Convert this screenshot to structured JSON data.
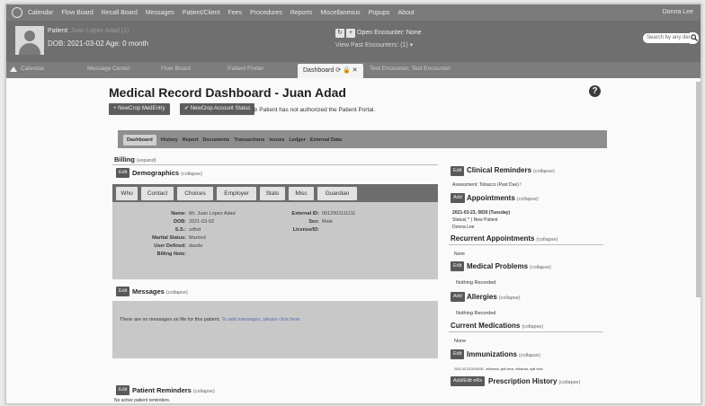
{
  "menu": {
    "items": [
      "Calendar",
      "Flow Board",
      "Recall Board",
      "Messages",
      "Patient/Client",
      "Fees",
      "Procedures",
      "Reports",
      "Miscellaneous",
      "Popups",
      "About"
    ],
    "user": "Donna Lee"
  },
  "patient_header": {
    "patient_label": "Patient:",
    "patient_name_obscured": "Juan Lopez Adad (1)",
    "dob_line": "DOB: 2021-03-02 Age: 0 month",
    "open_encounter": "Open Encounter: None",
    "past_encounters": "View Past Encounters: (1) ▾",
    "search_placeholder": "Search by any demographics"
  },
  "tabs": {
    "items": [
      "Calendar",
      "Message Center",
      "Flow Board",
      "Patient Finder"
    ],
    "active": "Dashboard",
    "right_tab": "Test Encounter, Test Encounter",
    "tab_icons": "⟳ 🔒 ✕"
  },
  "page": {
    "title": "Medical Record Dashboard - Juan Adad",
    "btn_newcrop_med": "NewCrop MedEntry",
    "btn_newcrop_acct": "NewCrop Account Status",
    "portal_note": "Patient has not authorized the Patient Portal.",
    "nav": [
      "Dashboard",
      "History",
      "Report",
      "Documents",
      "Transactions",
      "Issues",
      "Ledger",
      "External Data"
    ]
  },
  "left": {
    "billing": {
      "title": "Billing",
      "sub": "(expand)"
    },
    "demographics": {
      "edit": "Edit",
      "title": "Demographics",
      "sub": "(collapse)"
    },
    "demo_tabs": [
      "Who",
      "Contact",
      "Choices",
      "Employer",
      "Stats",
      "Misc",
      "Guardian"
    ],
    "fields": {
      "name_l": "Name:",
      "name_v": "Mr. Juan Lopez Adad",
      "dob_l": "DOB:",
      "dob_v": "2021-03-02",
      "ss_l": "S.S.:",
      "ss_v": "sdfsd",
      "marital_l": "Marital Status:",
      "marital_v": "Married",
      "userdef_l": "User Defined:",
      "userdef_v": "dasda",
      "billnote_l": "Billing Note:",
      "extid_l": "External ID:",
      "extid_v": "0012001111111",
      "sex_l": "Sex:",
      "sex_v": "Male",
      "license_l": "License/ID:"
    },
    "messages": {
      "edit": "Edit",
      "title": "Messages",
      "sub": "(collapse)",
      "text": "There are no messages on file for this patient.",
      "link": "To add messages, please click here."
    },
    "reminders": {
      "edit": "Edit",
      "title": "Patient Reminders",
      "sub": "(collapse)",
      "text": "No active patient reminders."
    }
  },
  "right": {
    "clinical": {
      "edit": "Edit",
      "title": "Clinical Reminders",
      "sub": "(collapse)",
      "text": "Assessment: Tobacco (Past Due) !"
    },
    "appointments": {
      "edit": "Add",
      "title": "Appointments",
      "sub": "(collapse)",
      "l1": "2021-03-23, 0830 (Tuesday)",
      "l2": "Status( * ) New Patient",
      "l3": "Donna Lee"
    },
    "recurrent": {
      "title": "Recurrent Appointments",
      "sub": "(collapse)",
      "text": "None"
    },
    "problems": {
      "edit": "Edit",
      "title": "Medical Problems",
      "sub": "(collapse)",
      "text": "Nothing Recorded"
    },
    "allergies": {
      "edit": "Add",
      "title": "Allergies",
      "sub": "(collapse)",
      "text": "Nothing Recorded"
    },
    "medications": {
      "title": "Current Medications",
      "sub": "(collapse)",
      "text": "None"
    },
    "immunizations": {
      "edit": "Edit",
      "title": "Immunizations",
      "sub": "(collapse)",
      "text": "2021-03-23 00:00:00 - influenza, split virus, influenza, split virus"
    },
    "prescription": {
      "edit": "Add/Edit eRx",
      "title": "Prescription History",
      "sub": "(collapse)"
    }
  }
}
